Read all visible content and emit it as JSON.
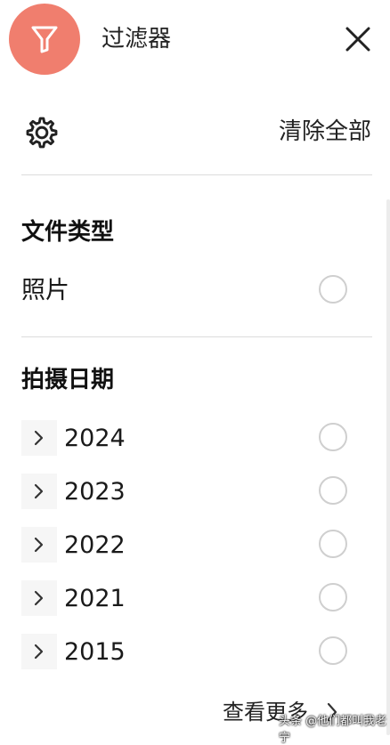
{
  "header": {
    "title": "过滤器"
  },
  "actions": {
    "clear_all": "清除全部"
  },
  "file_type": {
    "title": "文件类型",
    "items": [
      {
        "label": "照片",
        "selected": false
      }
    ]
  },
  "capture_date": {
    "title": "拍摄日期",
    "items": [
      {
        "label": "2024",
        "selected": false
      },
      {
        "label": "2023",
        "selected": false
      },
      {
        "label": "2022",
        "selected": false
      },
      {
        "label": "2021",
        "selected": false
      },
      {
        "label": "2015",
        "selected": false
      }
    ]
  },
  "footer": {
    "see_more": "查看更多"
  },
  "watermark": {
    "text": "头条 @他们都叫我老宁"
  },
  "colors": {
    "accent": "#f07e6e",
    "divider": "#dcdcdc",
    "radio_border": "#cfcfcf"
  },
  "icons": {
    "badge": "filter-icon",
    "close": "close-icon",
    "settings": "gear-icon",
    "expand": "chevron-right-icon"
  }
}
